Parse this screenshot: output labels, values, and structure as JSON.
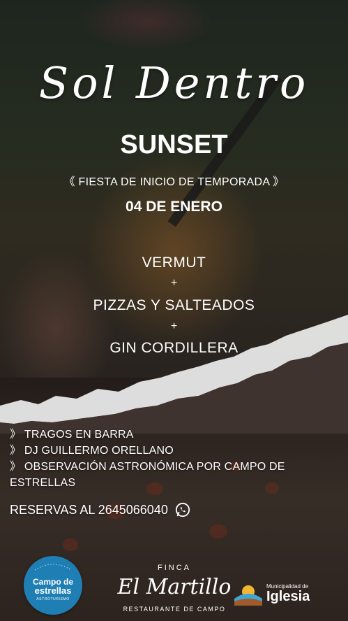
{
  "header": {
    "title": "Sol Dentro",
    "event": "SUNSET",
    "subtitle": "《 FIESTA DE INICIO DE TEMPORADA 》",
    "date": "04 DE ENERO"
  },
  "menu": {
    "items": [
      "VERMUT",
      "PIZZAS Y SALTEADOS",
      "GIN CORDILLERA"
    ],
    "separator": "+"
  },
  "features": [
    "》 TRAGOS EN BARRA",
    "》 DJ GUILLERMO ORELLANO",
    "》 OBSERVACIÓN ASTRONÓMICA POR CAMPO DE",
    "ESTRELLAS"
  ],
  "reservations": {
    "text": "RESERVAS AL 2645066040",
    "icon": "whatsapp-icon"
  },
  "footer": {
    "campo_logo": {
      "line1": "Campo de",
      "line2": "estrellas",
      "line3": "ASTROTURISMO"
    },
    "finca": {
      "top": "FINCA",
      "name": "El Martillo",
      "sub": "RESTAURANTE DE CAMPO"
    },
    "municipalidad": {
      "small": "Municipalidad de",
      "big": "Iglesia"
    }
  },
  "colors": {
    "text": "#ffffff",
    "campo_blue": "#1f7fb5",
    "tear": "#e8e8e8"
  }
}
